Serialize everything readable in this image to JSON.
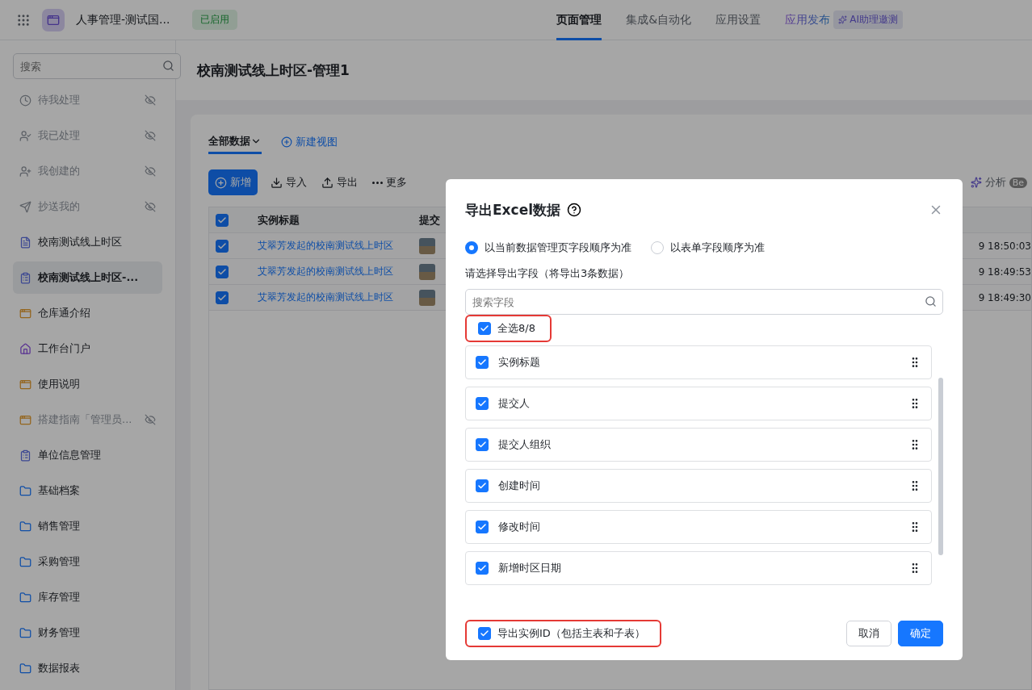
{
  "topbar": {
    "app_name": "人事管理-测试国...",
    "status": "已启用",
    "nav": [
      {
        "label": "页面管理",
        "selected": true,
        "kind": "plain"
      },
      {
        "label": "集成&自动化",
        "selected": false,
        "kind": "plain"
      },
      {
        "label": "应用设置",
        "selected": false,
        "kind": "plain"
      },
      {
        "label": "应用发布",
        "selected": false,
        "kind": "gradient"
      }
    ],
    "ai_badge": "AI助理邀测"
  },
  "sidebar": {
    "search": {
      "placeholder": "搜索"
    },
    "items": [
      {
        "label": "待我处理",
        "hidden": true,
        "selected": false
      },
      {
        "label": "我已处理",
        "hidden": true,
        "selected": false
      },
      {
        "label": "我创建的",
        "hidden": true,
        "selected": false
      },
      {
        "label": "抄送我的",
        "hidden": true,
        "selected": false
      },
      {
        "label": "校南测试线上时区",
        "hidden": false,
        "selected": false
      },
      {
        "label": "校南测试线上时区-...",
        "hidden": false,
        "selected": true
      },
      {
        "label": "仓库通介绍",
        "hidden": false,
        "selected": false
      },
      {
        "label": "工作台门户",
        "hidden": false,
        "selected": false
      },
      {
        "label": "使用说明",
        "hidden": false,
        "selected": false
      },
      {
        "label": "搭建指南「管理员...",
        "hidden": true,
        "selected": false
      },
      {
        "label": "单位信息管理",
        "hidden": false,
        "selected": false
      },
      {
        "label": "基础档案",
        "hidden": false,
        "selected": false
      },
      {
        "label": "销售管理",
        "hidden": false,
        "selected": false
      },
      {
        "label": "采购管理",
        "hidden": false,
        "selected": false
      },
      {
        "label": "库存管理",
        "hidden": false,
        "selected": false
      },
      {
        "label": "财务管理",
        "hidden": false,
        "selected": false
      },
      {
        "label": "数据报表",
        "hidden": false,
        "selected": false
      }
    ]
  },
  "page": {
    "title": "校南测试线上时区-管理1",
    "views": [
      {
        "label": "全部数据",
        "selected": true
      }
    ],
    "new_view": "新建视图",
    "toolbar": [
      {
        "label": "新增",
        "kind": "primary"
      },
      {
        "label": "导入",
        "kind": "import"
      },
      {
        "label": "导出",
        "kind": "export"
      },
      {
        "label": "更多",
        "kind": "more"
      }
    ],
    "analysis": "分析",
    "analysis_badge": "Be",
    "table": {
      "all_checked": true,
      "columns": [
        "实例标题",
        "提交"
      ],
      "rows": [
        {
          "checked": true,
          "title": "艾翠芳发起的校南测试线上时区",
          "time": "9 18:50:03"
        },
        {
          "checked": true,
          "title": "艾翠芳发起的校南测试线上时区",
          "time": "9 18:49:53"
        },
        {
          "checked": true,
          "title": "艾翠芳发起的校南测试线上时区",
          "time": "9 18:49:30"
        }
      ]
    }
  },
  "dialog": {
    "title": "导出Excel数据",
    "order_options": [
      {
        "label": "以当前数据管理页字段顺序为准",
        "selected": true
      },
      {
        "label": "以表单字段顺序为准",
        "selected": false
      }
    ],
    "fields_label": "请选择导出字段（将导出3条数据）",
    "search": {
      "placeholder": "搜索字段"
    },
    "select_all": {
      "label": "全选8/8",
      "checked": true,
      "highlighted": true
    },
    "fields": [
      {
        "label": "实例标题",
        "checked": true
      },
      {
        "label": "提交人",
        "checked": true
      },
      {
        "label": "提交人组织",
        "checked": true
      },
      {
        "label": "创建时间",
        "checked": true
      },
      {
        "label": "修改时间",
        "checked": true
      },
      {
        "label": "新增时区日期",
        "checked": true
      }
    ],
    "export_id": {
      "label": "导出实例ID（包括主表和子表）",
      "checked": true,
      "highlighted": true
    },
    "buttons": [
      {
        "label": "取消",
        "kind": "secondary"
      },
      {
        "label": "确定",
        "kind": "primary"
      }
    ]
  }
}
